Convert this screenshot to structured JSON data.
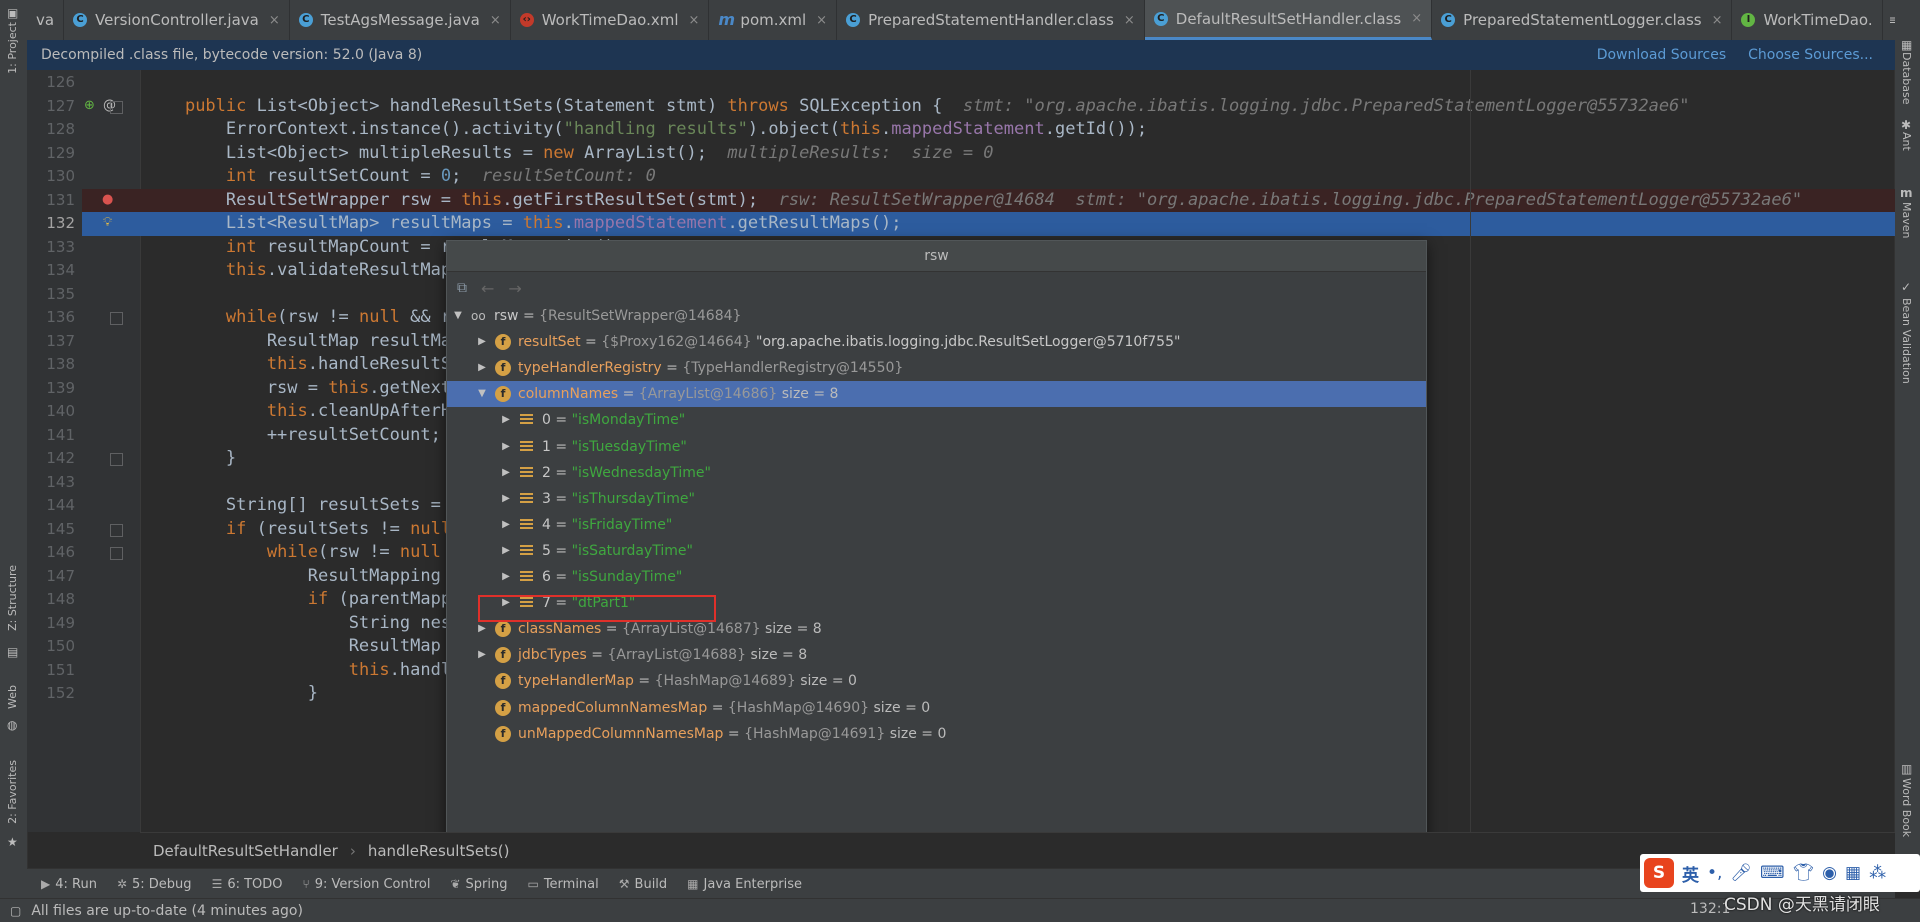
{
  "tabs": [
    {
      "label": "va",
      "icon": "",
      "partial": true
    },
    {
      "label": "VersionController.java",
      "icon": "class-icon"
    },
    {
      "label": "TestAgsMessage.java",
      "icon": "class-icon"
    },
    {
      "label": "WorkTimeDao.xml",
      "icon": "xml-icon"
    },
    {
      "label": "pom.xml",
      "icon": "maven-icon"
    },
    {
      "label": "PreparedStatementHandler.class",
      "icon": "compiled-class-icon"
    },
    {
      "label": "DefaultResultSetHandler.class",
      "icon": "compiled-class-icon",
      "active": true
    },
    {
      "label": "PreparedStatementLogger.class",
      "icon": "compiled-class-icon"
    },
    {
      "label": "WorkTimeDao.",
      "icon": "interface-icon"
    }
  ],
  "tabs_more": "≡",
  "decompile_bar": {
    "message": "Decompiled .class file, bytecode version: 52.0 (Java 8)",
    "download_sources": "Download Sources",
    "choose_sources": "Choose Sources..."
  },
  "left_strip": {
    "project": "1: Project",
    "structure": "Z: Structure",
    "web": "Web",
    "favorites": "2: Favorites"
  },
  "right_strip": {
    "database": "Database",
    "ant": "Ant",
    "maven": "Maven",
    "bean_validation": "Bean Validation",
    "word_book": "Word Book"
  },
  "code_lines": [
    {
      "n": "126",
      "html": ""
    },
    {
      "n": "127",
      "html": "    <span class='kw'>public</span> List&lt;Object&gt; handleResultSets(Statement stmt) <span class='kw'>throws</span> SQLException {  <span class='inl'>stmt: \"org.apache.ibatis.logging.jdbc.PreparedStatementLogger@55732ae6\"</span>"
    },
    {
      "n": "128",
      "html": "        ErrorContext.instance().activity(<span class='str'>\"handling results\"</span>).object(<span class='kw'>this</span>.<span class='fld'>mappedStatement</span>.getId());"
    },
    {
      "n": "129",
      "html": "        List&lt;Object&gt; multipleResults = <span class='kw'>new</span> ArrayList();  <span class='inl'>multipleResults:  size = 0</span>"
    },
    {
      "n": "130",
      "html": "        <span class='kw'>int</span> resultSetCount = <span class='num'>0</span>;  <span class='inl'>resultSetCount: 0</span>"
    },
    {
      "n": "131",
      "html": "        ResultSetWrapper rsw = <span class='kw'>this</span>.getFirstResultSet(stmt);  <span class='inl'>rsw: ResultSetWrapper@14684  stmt: \"org.apache.ibatis.logging.jdbc.PreparedStatementLogger@55732ae6\"</span>"
    },
    {
      "n": "132",
      "html": "        List&lt;ResultMap&gt; resultMaps = <span class='kw'>this</span>.<span class='fld'>mappedStatement</span>.getResultMaps();"
    },
    {
      "n": "133",
      "html": "        <span class='kw'>int</span> resultMapCount = resultMaps.size();"
    },
    {
      "n": "134",
      "html": "        <span class='kw'>this</span>.validateResultMapsCount(rsw, resultMapCount);"
    },
    {
      "n": "135",
      "html": ""
    },
    {
      "n": "136",
      "html": "        <span class='kw'>while</span>(rsw != <span class='kw'>null</span> &amp;&amp; resultMapCount &gt; resultSetCount) {"
    },
    {
      "n": "137",
      "html": "            ResultMap resultMap = (ResultMap)resultMaps.get(resultSetCount);"
    },
    {
      "n": "138",
      "html": "            <span class='kw'>this</span>.handleResultSet(rsw, resultMap, multipleResults, (ResultMapping)<span class='kw'>null</span>);"
    },
    {
      "n": "139",
      "html": "            rsw = <span class='kw'>this</span>.getNextResultSet(stmt);"
    },
    {
      "n": "140",
      "html": "            <span class='kw'>this</span>.cleanUpAfterHandlingResultSet();"
    },
    {
      "n": "141",
      "html": "            ++resultSetCount;"
    },
    {
      "n": "142",
      "html": "        }"
    },
    {
      "n": "143",
      "html": ""
    },
    {
      "n": "144",
      "html": "        String[] resultSets = <span class='kw'>this</span>.<span class='fld'>mappedStatement</span>.getResultSets();"
    },
    {
      "n": "145",
      "html": "        <span class='kw'>if</span> (resultSets != <span class='kw'>null</span>) {"
    },
    {
      "n": "146",
      "html": "            <span class='kw'>while</span>(rsw != <span class='kw'>null</span> &amp;&amp; resultSetCount &lt; resultSets.length) {"
    },
    {
      "n": "147",
      "html": "                ResultMapping parentMapping = (ResultMapping)<span class='kw'>this</span>.<span class='fld'>nextResultMaps</span>.get(resultSets[resultSetCount]);"
    },
    {
      "n": "148",
      "html": "                <span class='kw'>if</span> (parentMapping != <span class='kw'>null</span>) {"
    },
    {
      "n": "149",
      "html": "                    String nestedResultMapId = parentMapping.getNestedResultMapId();"
    },
    {
      "n": "150",
      "html": "                    ResultMap resultMap = <span class='kw'>this</span>.<span class='fld'>configuration</span>.getResultMap(nestedResultMapId);"
    },
    {
      "n": "151",
      "html": "                    <span class='kw'>this</span>.handleResultSet(rsw, resultMap, (List)<span class='kw'>null</span>, parentMapping);"
    },
    {
      "n": "152",
      "html": "                }"
    }
  ],
  "popup": {
    "title": "rsw",
    "root": {
      "name": "rsw",
      "type": "{ResultSetWrapper@14684}"
    },
    "fields": [
      {
        "name": "resultSet",
        "type": "{$Proxy162@14664}",
        "value": "\"org.apache.ibatis.logging.jdbc.ResultSetLogger@5710f755\""
      },
      {
        "name": "typeHandlerRegistry",
        "type": "{TypeHandlerRegistry@14550}",
        "value": ""
      },
      {
        "name": "columnNames",
        "type": "{ArrayList@14686}",
        "value": "size = 8",
        "expanded": true
      },
      {
        "name": "classNames",
        "type": "{ArrayList@14687}",
        "value": "size = 8"
      },
      {
        "name": "jdbcTypes",
        "type": "{ArrayList@14688}",
        "value": "size = 8"
      },
      {
        "name": "typeHandlerMap",
        "type": "{HashMap@14689}",
        "value": "size = 0",
        "noarrow": true
      },
      {
        "name": "mappedColumnNamesMap",
        "type": "{HashMap@14690}",
        "value": "size = 0",
        "noarrow": true
      },
      {
        "name": "unMappedColumnNamesMap",
        "type": "{HashMap@14691}",
        "value": "size = 0",
        "noarrow": true
      }
    ],
    "column_names": [
      {
        "index": "0",
        "value": "\"isMondayTime\""
      },
      {
        "index": "1",
        "value": "\"isTuesdayTime\""
      },
      {
        "index": "2",
        "value": "\"isWednesdayTime\""
      },
      {
        "index": "3",
        "value": "\"isThursdayTime\""
      },
      {
        "index": "4",
        "value": "\"isFridayTime\""
      },
      {
        "index": "5",
        "value": "\"isSaturdayTime\""
      },
      {
        "index": "6",
        "value": "\"isSundayTime\""
      },
      {
        "index": "7",
        "value": "\"dtPart1\""
      }
    ]
  },
  "breadcrumb": {
    "class": "DefaultResultSetHandler",
    "method": "handleResultSets()"
  },
  "tool_windows": [
    {
      "label": "4: Run",
      "icon": "run-icon"
    },
    {
      "label": "5: Debug",
      "icon": "debug-icon"
    },
    {
      "label": "6: TODO",
      "icon": "todo-icon"
    },
    {
      "label": "9: Version Control",
      "icon": "vcs-icon"
    },
    {
      "label": "Spring",
      "icon": "spring-icon"
    },
    {
      "label": "Terminal",
      "icon": "terminal-icon"
    },
    {
      "label": "Build",
      "icon": "build-icon"
    },
    {
      "label": "Java Enterprise",
      "icon": "java-ee-icon"
    }
  ],
  "status": {
    "message": "All files are up-to-date (4 minutes ago)",
    "caret": "132:1"
  },
  "ime": {
    "label": "英",
    "punct": "•,"
  },
  "watermark": "CSDN @天黑请闭眼",
  "colors": {
    "accent": "#4a88c7",
    "selection": "#2d5c9e",
    "highlight_box": "#e0302a",
    "string_value": "#3fa83f"
  }
}
